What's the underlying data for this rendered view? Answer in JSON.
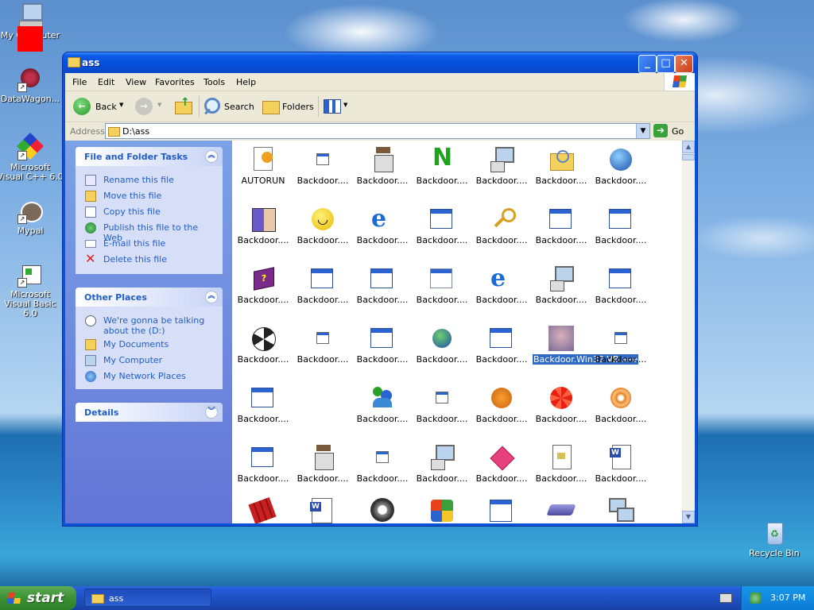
{
  "desktop": {
    "icons": [
      {
        "label": "My Computer",
        "icon": "my-computer-icon"
      },
      {
        "label": "DataWagon...",
        "icon": "datawagon-icon"
      },
      {
        "label": "Microsoft Visual C++ 6.0",
        "icon": "visual-cpp-icon"
      },
      {
        "label": "Mypal",
        "icon": "mypal-icon"
      },
      {
        "label": "Microsoft Visual Basic 6.0",
        "icon": "visual-basic-icon"
      },
      {
        "label": "Recycle Bin",
        "icon": "recycle-bin-icon"
      }
    ]
  },
  "window": {
    "title": "ass",
    "menu": [
      "File",
      "Edit",
      "View",
      "Favorites",
      "Tools",
      "Help"
    ],
    "toolbar": {
      "back": "Back",
      "search": "Search",
      "folders": "Folders"
    },
    "address": {
      "label": "Address",
      "path": "D:\\ass",
      "go": "Go"
    }
  },
  "tasks": {
    "file_folder": {
      "title": "File and Folder Tasks",
      "items": [
        {
          "label": "Rename this file",
          "icon": "rename-icon"
        },
        {
          "label": "Move this file",
          "icon": "move-icon"
        },
        {
          "label": "Copy this file",
          "icon": "copy-icon"
        },
        {
          "label": "Publish this file to the Web",
          "icon": "publish-icon"
        },
        {
          "label": "E-mail this file",
          "icon": "email-icon"
        },
        {
          "label": "Delete this file",
          "icon": "delete-icon"
        }
      ]
    },
    "other_places": {
      "title": "Other Places",
      "items": [
        {
          "label": "We're gonna be talking about the (D:)",
          "icon": "drive-icon"
        },
        {
          "label": "My Documents",
          "icon": "my-documents-icon"
        },
        {
          "label": "My Computer",
          "icon": "my-computer-icon"
        },
        {
          "label": "My Network Places",
          "icon": "network-places-icon"
        }
      ]
    },
    "details": {
      "title": "Details"
    }
  },
  "files": {
    "row1": [
      {
        "label": "AUTORUN",
        "icon": "autorun-icon"
      },
      {
        "label": "Backdoor....",
        "icon": "small-window-icon"
      },
      {
        "label": "Backdoor....",
        "icon": "installer-icon"
      },
      {
        "label": "Backdoor....",
        "icon": "green-n-icon"
      },
      {
        "label": "Backdoor....",
        "icon": "computer-setup-icon"
      },
      {
        "label": "Backdoor....",
        "icon": "search-folder-icon"
      },
      {
        "label": "Backdoor....",
        "icon": "globe-arrow-icon"
      }
    ],
    "row2": [
      {
        "label": "Backdoor....",
        "icon": "finder-face-icon"
      },
      {
        "label": "Backdoor....",
        "icon": "smiley-icon"
      },
      {
        "label": "Backdoor....",
        "icon": "internet-explorer-icon"
      },
      {
        "label": "Backdoor....",
        "icon": "window-icon"
      },
      {
        "label": "Backdoor....",
        "icon": "key-icon"
      },
      {
        "label": "Backdoor....",
        "icon": "window-icon"
      },
      {
        "label": "Backdoor....",
        "icon": "window-icon"
      }
    ],
    "row3": [
      {
        "label": "Backdoor....",
        "icon": "help-book-icon"
      },
      {
        "label": "Backdoor....",
        "icon": "window-icon"
      },
      {
        "label": "Backdoor....",
        "icon": "window-icon"
      },
      {
        "label": "Backdoor....",
        "icon": "window-icon"
      },
      {
        "label": "Backdoor....",
        "icon": "internet-explorer-icon"
      },
      {
        "label": "Backdoor....",
        "icon": "computer-setup-icon"
      },
      {
        "label": "Backdoor....",
        "icon": "window-icon"
      }
    ],
    "row4": [
      {
        "label": "Backdoor....",
        "icon": "radiation-icon"
      },
      {
        "label": "Backdoor....",
        "icon": "small-window-icon"
      },
      {
        "label": "Backdoor....",
        "icon": "window-icon"
      },
      {
        "label": "Backdoor....",
        "icon": "globe-icon"
      },
      {
        "label": "Backdoor....",
        "icon": "window-icon"
      },
      {
        "label": "Backdoor.Win32.VB.aee",
        "icon": "photo-icon",
        "selected": true
      },
      {
        "label": "Backdoor....",
        "icon": "small-window-icon"
      }
    ],
    "row5": [
      {
        "label": "Backdoor....",
        "icon": "window-icon"
      },
      {
        "label": "Backdoor....",
        "icon": "messenger-icon"
      },
      {
        "label": "Backdoor....",
        "icon": "small-window-icon"
      },
      {
        "label": "Backdoor....",
        "icon": "garfield-icon"
      },
      {
        "label": "Backdoor....",
        "icon": "red-flower-icon"
      },
      {
        "label": "Backdoor....",
        "icon": "spiral-icon"
      }
    ],
    "row6": [
      {
        "label": "Backdoor....",
        "icon": "window-icon"
      },
      {
        "label": "Backdoor....",
        "icon": "installer-icon"
      },
      {
        "label": "Backdoor....",
        "icon": "small-window-icon"
      },
      {
        "label": "Backdoor....",
        "icon": "computer-setup-icon"
      },
      {
        "label": "Backdoor....",
        "icon": "pink-diamond-icon"
      },
      {
        "label": "Backdoor....",
        "icon": "document-icon"
      },
      {
        "label": "Backdoor....",
        "icon": "word-document-icon"
      }
    ]
  },
  "taskbar": {
    "start": "start",
    "task": "ass",
    "clock": "3:07 PM"
  },
  "colors": {
    "selection": "#316ac5",
    "task_link": "#215dc6",
    "title_bar": "#0550d8"
  }
}
